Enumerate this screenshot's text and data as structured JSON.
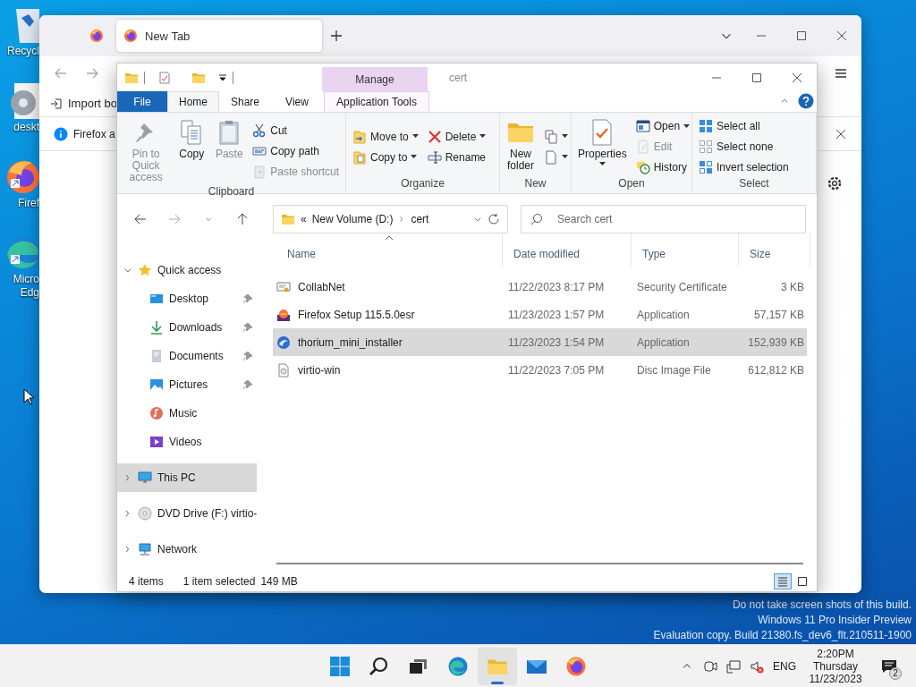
{
  "desktop_icons": [
    {
      "kind": "recycle",
      "label": "Recycl",
      "shortcut": false
    },
    {
      "kind": "settings",
      "label": "deskt",
      "shortcut": false
    },
    {
      "kind": "firefox",
      "label": "Firef",
      "shortcut": true
    },
    {
      "kind": "edge",
      "label": "Micro\nEdg",
      "shortcut": true
    }
  ],
  "browser": {
    "tabs": [
      {
        "kind": "pinned",
        "selected": false
      },
      {
        "kind": "page",
        "label": "New Tab",
        "selected": true
      }
    ],
    "bookmarks": [
      {
        "label": "Import bo"
      }
    ],
    "notice": {
      "text": "Firefox a"
    }
  },
  "explorer": {
    "title": "cert",
    "context_tab": "Manage",
    "ribbon_tabs": [
      {
        "label": "File",
        "kind": "file",
        "selected": false
      },
      {
        "label": "Home",
        "kind": "tab",
        "selected": true
      },
      {
        "label": "Share",
        "kind": "tab",
        "selected": false
      },
      {
        "label": "View",
        "kind": "tab",
        "selected": false
      },
      {
        "label": "Application Tools",
        "kind": "context",
        "selected": false
      }
    ],
    "ribbon": [
      {
        "label": "Clipboard",
        "columns": [
          {
            "kind": "large",
            "label": "Pin to Quick\naccess",
            "disabled": true,
            "dropdown": false
          },
          {
            "kind": "large",
            "label": "Copy",
            "disabled": false,
            "dropdown": false
          },
          {
            "kind": "large",
            "label": "Paste",
            "disabled": true,
            "dropdown": false
          },
          {
            "kind": "stack",
            "items": [
              {
                "kind": "button",
                "label": "Cut",
                "disabled": false,
                "dropdown": false
              },
              {
                "kind": "button",
                "label": "Copy path",
                "disabled": false,
                "dropdown": false
              },
              {
                "kind": "button",
                "label": "Paste shortcut",
                "disabled": true,
                "dropdown": false
              }
            ]
          }
        ]
      },
      {
        "label": "Organize",
        "columns": [
          {
            "kind": "stack",
            "items": [
              {
                "kind": "button",
                "label": "Move to",
                "disabled": false,
                "dropdown": true
              },
              {
                "kind": "button",
                "label": "Copy to",
                "disabled": false,
                "dropdown": true
              }
            ]
          },
          {
            "kind": "stack",
            "items": [
              {
                "kind": "button",
                "label": "Delete",
                "disabled": false,
                "dropdown": true
              },
              {
                "kind": "button",
                "label": "Rename",
                "disabled": false,
                "dropdown": false
              }
            ]
          }
        ]
      },
      {
        "label": "New",
        "columns": [
          {
            "kind": "large",
            "label": "New\nfolder",
            "disabled": false,
            "dropdown": false
          },
          {
            "kind": "stack",
            "items": [
              {
                "kind": "icon",
                "disabled": false,
                "dropdown": true
              },
              {
                "kind": "icon",
                "disabled": false,
                "dropdown": true
              }
            ]
          }
        ]
      },
      {
        "label": "Open",
        "columns": [
          {
            "kind": "large",
            "label": "Properties",
            "disabled": false,
            "dropdown": true
          },
          {
            "kind": "stack",
            "items": [
              {
                "kind": "button",
                "label": "Open",
                "disabled": false,
                "dropdown": true
              },
              {
                "kind": "button",
                "label": "Edit",
                "disabled": true,
                "dropdown": false
              },
              {
                "kind": "button",
                "label": "History",
                "disabled": false,
                "dropdown": false
              }
            ]
          }
        ]
      },
      {
        "label": "Select",
        "columns": [
          {
            "kind": "stack",
            "items": [
              {
                "kind": "button",
                "label": "Select all",
                "disabled": false,
                "dropdown": false
              },
              {
                "kind": "button",
                "label": "Select none",
                "disabled": false,
                "dropdown": false
              },
              {
                "kind": "button",
                "label": "Invert selection",
                "disabled": false,
                "dropdown": false
              }
            ]
          }
        ]
      }
    ],
    "address": {
      "overflow": "«",
      "path": [
        "New Volume (D:)",
        "cert"
      ]
    },
    "search": {
      "placeholder": "Search cert"
    },
    "nav": [
      {
        "kind": "star",
        "label": "Quick access",
        "expanded": true,
        "selected": false,
        "children": [
          {
            "kind": "desktop",
            "label": "Desktop",
            "pinned": true,
            "selected": false
          },
          {
            "kind": "download",
            "label": "Downloads",
            "pinned": true,
            "selected": false
          },
          {
            "kind": "documents",
            "label": "Documents",
            "pinned": true,
            "selected": false
          },
          {
            "kind": "pictures",
            "label": "Pictures",
            "pinned": true,
            "selected": false
          },
          {
            "kind": "music",
            "label": "Music",
            "pinned": false,
            "selected": false
          },
          {
            "kind": "videos",
            "label": "Videos",
            "pinned": false,
            "selected": false
          }
        ]
      },
      {
        "kind": "pc",
        "label": "This PC",
        "expanded": false,
        "selected": true
      },
      {
        "kind": "dvd",
        "label": "DVD Drive (F:) virtio-",
        "expanded": false,
        "selected": false
      },
      {
        "kind": "network",
        "label": "Network",
        "expanded": false,
        "selected": false
      }
    ],
    "columns": [
      {
        "label": "Name",
        "sorted": true
      },
      {
        "label": "Date modified",
        "sorted": false
      },
      {
        "label": "Type",
        "sorted": false
      },
      {
        "label": "Size",
        "sorted": false
      }
    ],
    "files": [
      {
        "kind": "certificate",
        "name": "CollabNet",
        "date": "11/22/2023 8:17 PM",
        "type": "Security Certificate",
        "size": "3 KB",
        "selected": false
      },
      {
        "kind": "firefox",
        "name": "Firefox Setup 115.5.0esr",
        "date": "11/23/2023 1:57 PM",
        "type": "Application",
        "size": "57,157 KB",
        "selected": false
      },
      {
        "kind": "thorium",
        "name": "thorium_mini_installer",
        "date": "11/23/2023 1:54 PM",
        "type": "Application",
        "size": "152,939 KB",
        "selected": true
      },
      {
        "kind": "disc",
        "name": "virtio-win",
        "date": "11/22/2023 7:05 PM",
        "type": "Disc Image File",
        "size": "612,812 KB",
        "selected": false
      }
    ],
    "status": {
      "count": "4 items",
      "selection": "1 item selected",
      "size": "149 MB"
    },
    "views": [
      {
        "kind": "details",
        "selected": true
      },
      {
        "kind": "large_icons",
        "selected": false
      }
    ]
  },
  "build_notice": [
    "Do not take screen shots of this build.",
    "Windows 11 Pro Insider Preview",
    "Evaluation copy. Build 21380.fs_dev6_flt.210511-1900"
  ],
  "taskbar": {
    "apps": [
      {
        "kind": "start",
        "active": false
      },
      {
        "kind": "search",
        "active": false
      },
      {
        "kind": "taskview",
        "active": false
      },
      {
        "kind": "edge",
        "active": false
      },
      {
        "kind": "explorer",
        "active": true
      },
      {
        "kind": "mail",
        "active": false
      },
      {
        "kind": "firefox",
        "active": false
      }
    ],
    "tray": {
      "language": "ENG",
      "time": "2:20PM",
      "day": "Thursday",
      "date": "11/23/2023",
      "notifications": "2"
    }
  }
}
